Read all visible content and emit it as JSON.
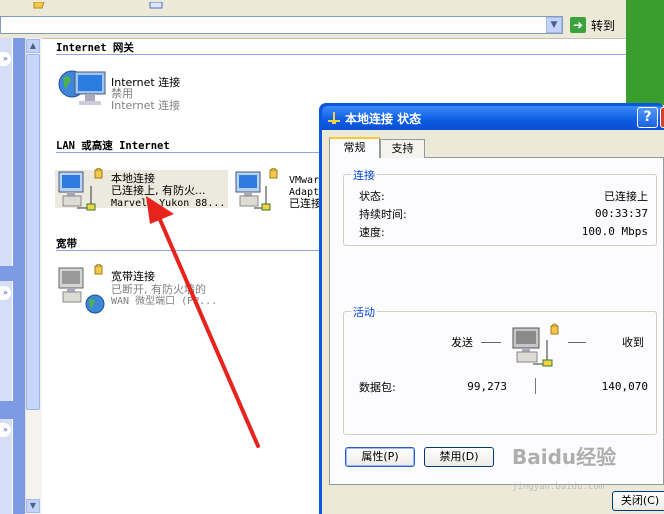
{
  "address_bar": {
    "go_label": "转到"
  },
  "groups": [
    {
      "title": "Internet 网关",
      "items": [
        {
          "name": "Internet 连接",
          "status": "禁用",
          "device": "Internet 连接"
        }
      ]
    },
    {
      "title": "LAN 或高速 Internet",
      "items": [
        {
          "name": "本地连接",
          "status": "已连接上, 有防火...",
          "device": "Marvell Yukon 88..."
        },
        {
          "name": "VMwar",
          "status": "Adapt",
          "device": "已连接"
        }
      ]
    },
    {
      "title": "宽带",
      "items": [
        {
          "name": "宽带连接",
          "status": "已断开, 有防火墙的",
          "device": "WAN 微型端口 (PP..."
        }
      ]
    }
  ],
  "dialog": {
    "title": "本地连接 状态",
    "help_label": "?",
    "tabs": [
      {
        "label": "常规",
        "active": true
      },
      {
        "label": "支持",
        "active": false
      }
    ],
    "connection": {
      "legend": "连接",
      "rows": [
        {
          "label": "状态:",
          "value": "已连接上"
        },
        {
          "label": "持续时间:",
          "value": "00:33:37"
        },
        {
          "label": "速度:",
          "value": "100.0 Mbps"
        }
      ]
    },
    "activity": {
      "legend": "活动",
      "sent_label": "发送",
      "received_label": "收到",
      "packets_label": "数据包:",
      "packets_sent": "99,273",
      "packets_received": "140,070"
    },
    "buttons": {
      "properties": "属性(P)",
      "disable": "禁用(D)",
      "close": "关闭(C)"
    }
  },
  "watermark": {
    "text": "Baidu经验",
    "url": "jingyan.baidu.com"
  },
  "colors": {
    "title_bar": "#0c5be4",
    "annotation_arrow": "#e8231e",
    "desktop": "#3a9e2e"
  }
}
